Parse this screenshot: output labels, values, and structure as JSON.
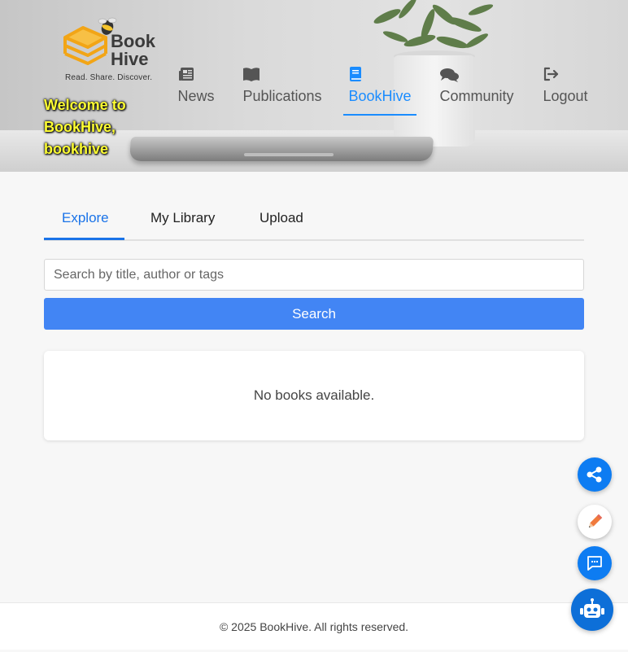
{
  "brand": {
    "name_line1": "Book",
    "name_line2": "Hive",
    "tagline": "Read. Share. Discover.",
    "welcome": "Welcome to BookHive, bookhive"
  },
  "nav": {
    "items": [
      {
        "label": "News",
        "icon": "newspaper-icon"
      },
      {
        "label": "Publications",
        "icon": "open-book-icon"
      },
      {
        "label": "BookHive",
        "icon": "book-icon",
        "active": true
      },
      {
        "label": "Community",
        "icon": "comments-icon"
      },
      {
        "label": "Logout",
        "icon": "logout-icon"
      }
    ]
  },
  "tabs": [
    {
      "label": "Explore",
      "active": true
    },
    {
      "label": "My Library"
    },
    {
      "label": "Upload"
    }
  ],
  "search": {
    "placeholder": "Search by title, author or tags",
    "value": "",
    "button_label": "Search"
  },
  "results": {
    "empty_message": "No books available."
  },
  "footer": {
    "text": "© 2025 BookHive. All rights reserved."
  },
  "colors": {
    "accent": "#1a8cff",
    "search_button": "#4285f4",
    "fab_blue": "#0d7cf2",
    "welcome_text": "#ffff33"
  },
  "floating_actions": [
    "share-icon",
    "pencil-icon",
    "chat-icon",
    "robot-icon"
  ]
}
